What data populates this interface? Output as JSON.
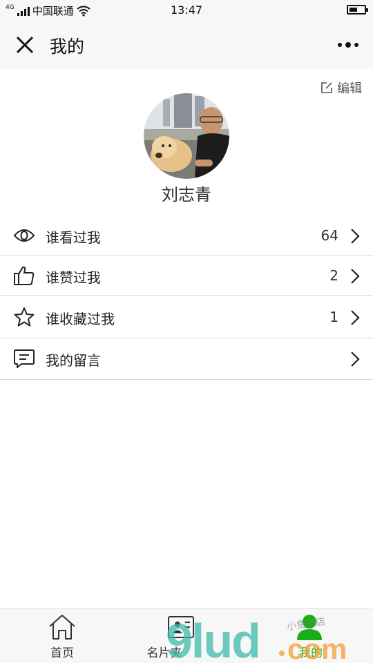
{
  "status_bar": {
    "network": "4G",
    "carrier": "中国联通",
    "time": "13:47",
    "battery_level": 0.55,
    "wifi_icon": "wifi-icon"
  },
  "header": {
    "title": "我的",
    "close_icon": "close-icon",
    "more_icon": "more-icon"
  },
  "profile": {
    "edit_label": "编辑",
    "name": "刘志青"
  },
  "menu": [
    {
      "label": "谁看过我",
      "count": "64",
      "icon": "eye-icon"
    },
    {
      "label": "谁赞过我",
      "count": "2",
      "icon": "thumbs-up-icon"
    },
    {
      "label": "谁收藏过我",
      "count": "1",
      "icon": "star-icon"
    },
    {
      "label": "我的留言",
      "count": "",
      "icon": "message-icon"
    }
  ],
  "tabbar": {
    "tabs": [
      {
        "label": "首页",
        "icon": "home-icon"
      },
      {
        "label": "名片夹",
        "icon": "contact-card-icon"
      },
      {
        "label": "我的",
        "icon": "profile-icon",
        "active": true
      }
    ]
  },
  "watermark": {
    "logo_text": "9lud.com",
    "script_text": "小鱼商店"
  },
  "colors": {
    "accent": "#1aad19",
    "header_bg": "#f7f7f7",
    "divider": "#dcdcdc"
  }
}
